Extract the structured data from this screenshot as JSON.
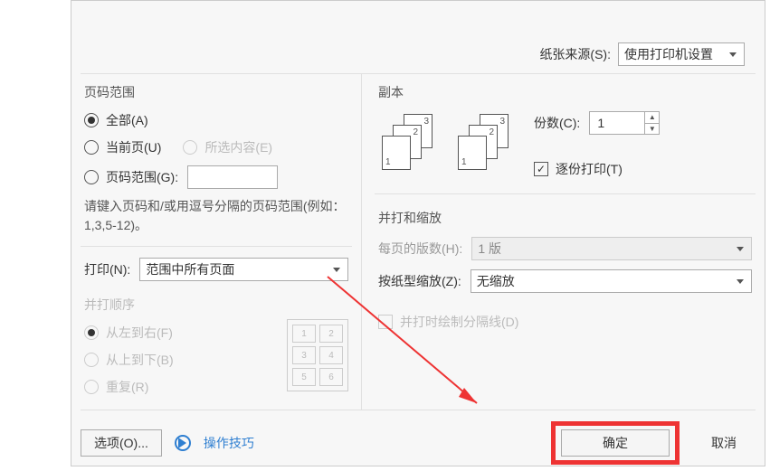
{
  "paper_source": {
    "label": "纸张来源(S):",
    "value": "使用打印机设置"
  },
  "page_range": {
    "title": "页码范围",
    "all": "全部(A)",
    "current": "当前页(U)",
    "selection": "所选内容(E)",
    "range": "页码范围(G):",
    "range_value": "",
    "hint": "请键入页码和/或用逗号分隔的页码范围(例如：1,3,5-12)。"
  },
  "copies": {
    "title": "副本",
    "label": "份数(C):",
    "value": "1",
    "collate": "逐份打印(T)"
  },
  "print_what": {
    "label": "打印(N):",
    "value": "范围中所有页面"
  },
  "zoom": {
    "title": "并打和缩放",
    "pages_per_sheet_label": "每页的版数(H):",
    "pages_per_sheet_value": "1 版",
    "scale_label": "按纸型缩放(Z):",
    "scale_value": "无缩放",
    "draw_borders": "并打时绘制分隔线(D)"
  },
  "nup_order": {
    "title": "并打顺序",
    "ltr": "从左到右(F)",
    "ttb": "从上到下(B)",
    "repeat": "重复(R)"
  },
  "buttons": {
    "options": "选项(O)...",
    "tips": "操作技巧",
    "ok": "确定",
    "cancel": "取消"
  }
}
